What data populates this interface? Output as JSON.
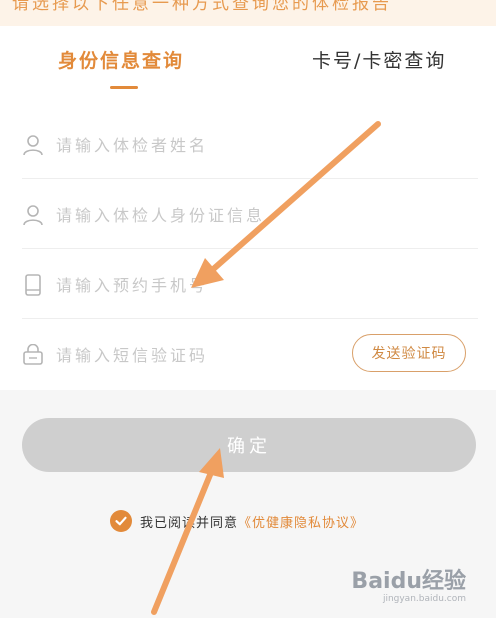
{
  "banner": {
    "text": "请选择以下任意一种方式查询您的体检报告"
  },
  "tabs": [
    {
      "label": "身份信息查询",
      "active": true
    },
    {
      "label": "卡号/卡密查询",
      "active": false
    }
  ],
  "form": {
    "name": {
      "placeholder": "请输入体检者姓名",
      "icon": "user-icon"
    },
    "id_card": {
      "placeholder": "请输入体检人身份证信息",
      "icon": "user-icon"
    },
    "phone": {
      "placeholder": "请输入预约手机号",
      "icon": "phone-icon"
    },
    "sms_code": {
      "placeholder": "请输入短信验证码",
      "icon": "lock-icon"
    },
    "send_code_label": "发送验证码"
  },
  "confirm_label": "确定",
  "agreement": {
    "checked": true,
    "text": "我已阅读并同意",
    "link": "《优健康隐私协议》"
  },
  "watermark": {
    "text": "Baidu经验",
    "sub": "jingyan.baidu.com"
  },
  "colors": {
    "accent": "#e28a3a",
    "arrow": "#f0a060",
    "button_disabled": "#cfcfcf"
  }
}
